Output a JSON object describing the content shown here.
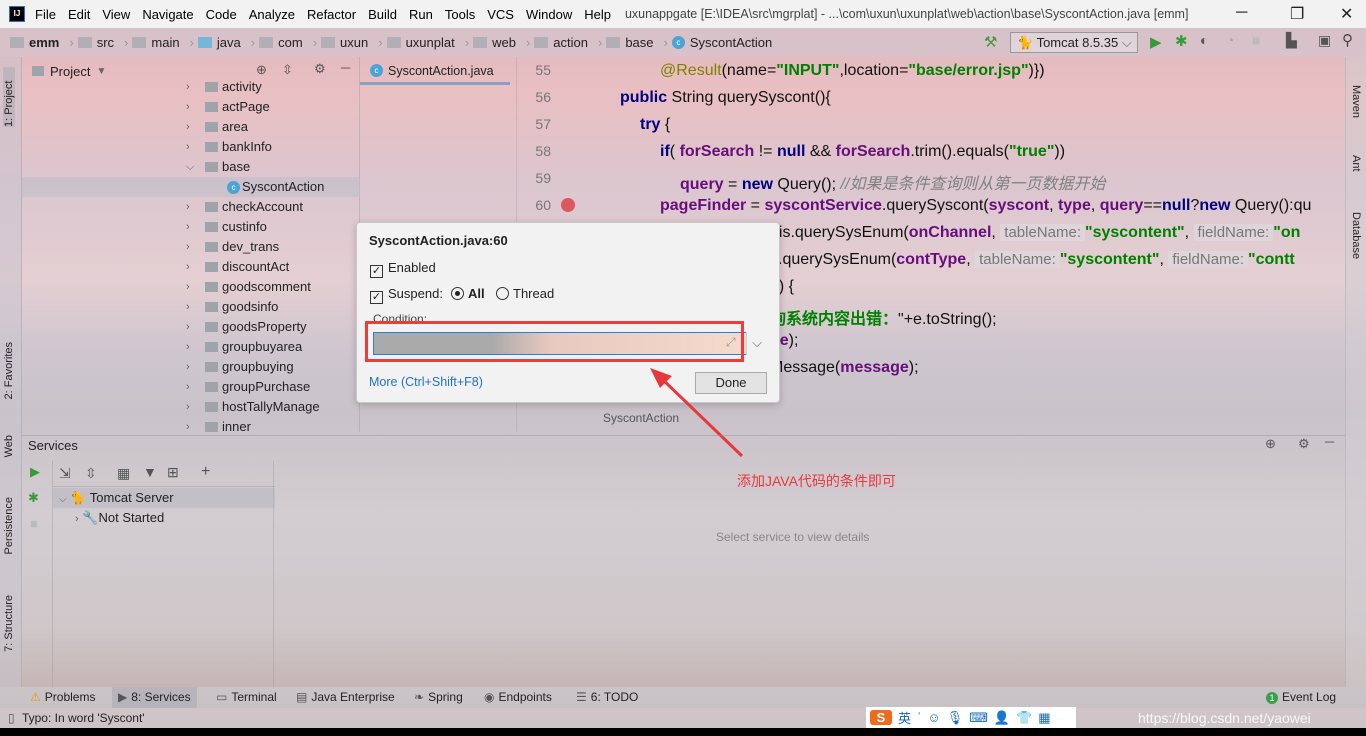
{
  "window": {
    "title": "uxunappgate [E:\\IDEA\\src\\mgrplat] - ...\\com\\uxun\\uxunplat\\web\\action\\base\\SyscontAction.java [emm]"
  },
  "menu": [
    "File",
    "Edit",
    "View",
    "Navigate",
    "Code",
    "Analyze",
    "Refactor",
    "Build",
    "Run",
    "Tools",
    "VCS",
    "Window",
    "Help"
  ],
  "breadcrumbs": [
    "emm",
    "src",
    "main",
    "java",
    "com",
    "uxun",
    "uxunplat",
    "web",
    "action",
    "base",
    "SyscontAction"
  ],
  "run_config": "Tomcat 8.5.35",
  "left_tools": [
    "1: Project",
    "2: Favorites",
    "Web",
    "Persistence",
    "7: Structure"
  ],
  "right_tools": [
    "Maven",
    "Ant",
    "Database"
  ],
  "project": {
    "title": "Project",
    "items": [
      {
        "label": "activity",
        "expanded": false
      },
      {
        "label": "actPage",
        "expanded": false
      },
      {
        "label": "area",
        "expanded": false
      },
      {
        "label": "bankInfo",
        "expanded": false
      },
      {
        "label": "base",
        "expanded": true
      },
      {
        "label": "SyscontAction",
        "child": true,
        "selected": true
      },
      {
        "label": "checkAccount"
      },
      {
        "label": "custinfo"
      },
      {
        "label": "dev_trans"
      },
      {
        "label": "discountAct"
      },
      {
        "label": "goodscomment"
      },
      {
        "label": "goodsinfo"
      },
      {
        "label": "goodsProperty"
      },
      {
        "label": "groupbuyarea"
      },
      {
        "label": "groupbuying"
      },
      {
        "label": "groupPurchase"
      },
      {
        "label": "hostTallyManage"
      },
      {
        "label": "inner"
      }
    ]
  },
  "editor": {
    "tab": "SyscontAction.java",
    "line_numbers": [
      "55",
      "56",
      "57",
      "58",
      "59",
      "60"
    ],
    "breakpoint_line": "60",
    "footer_crumb": "SyscontAction",
    "code": {
      "l55": [
        "@Result",
        "(name=",
        "\"INPUT\"",
        ",location=",
        "\"base/error.jsp\"",
        ")})"
      ],
      "l56": [
        "public",
        " String querySyscont(){"
      ],
      "l57": [
        "try",
        " {"
      ],
      "l58": [
        "if",
        "( ",
        "forSearch",
        " != ",
        "null",
        " && ",
        "forSearch",
        ".trim().equals(",
        "\"true\"",
        "))"
      ],
      "l59": [
        "query",
        " = ",
        "new",
        " Query(); ",
        "//如果是条件查询则从第一页数据开始"
      ],
      "l60": [
        "pageFinder",
        " = ",
        "syscontService",
        ".querySyscont(",
        "syscont",
        ", ",
        "type",
        ", ",
        "query",
        "==",
        "null",
        "?",
        "new",
        " Query():qu"
      ],
      "l61": [
        "his",
        ".querySysEnum(",
        "onChannel",
        ", ",
        "tableName:",
        "\"syscontent\"",
        ", ",
        "fieldName:",
        "\"on"
      ],
      "l62": [
        "s",
        ".querySysEnum(",
        "contType",
        ", ",
        "tableName:",
        "\"syscontent\"",
        ", ",
        "fieldName:",
        "\"contt"
      ],
      "l63": [
        "e) {"
      ],
      "l64": [
        "询系统内容出错：",
        "\"+e.toString();"
      ],
      "l65": [
        "ge",
        "); "
      ],
      "l66": [
        "Message(",
        "message",
        ");"
      ]
    }
  },
  "dialog": {
    "title": "SyscontAction.java:60",
    "enabled_label": "Enabled",
    "enabled": true,
    "suspend_label": "Suspend:",
    "suspend": true,
    "all_label": "All",
    "thread_label": "Thread",
    "suspend_mode": "All",
    "condition_label": "Condition:",
    "condition_value": "",
    "more_link": "More (Ctrl+Shift+F8)",
    "done_label": "Done"
  },
  "annotation": {
    "text": "添加JAVA代码的条件即可",
    "color": "#e8383d"
  },
  "services": {
    "title": "Services",
    "tree": [
      {
        "label": "Tomcat Server"
      },
      {
        "label": "Not Started"
      }
    ],
    "placeholder": "Select service to view details"
  },
  "bottom_tabs": [
    "Problems",
    "8: Services",
    "Terminal",
    "Java Enterprise",
    "Spring",
    "Endpoints",
    "6: TODO"
  ],
  "event_log": "Event Log",
  "status": {
    "message": "Typo: In word 'Syscont'",
    "watermark": "https://blog.csdn.net/yaowei"
  },
  "ime": {
    "lang": "英"
  }
}
